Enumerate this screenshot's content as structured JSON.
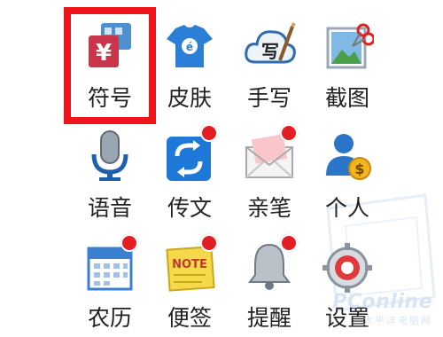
{
  "items": [
    {
      "label": "符号"
    },
    {
      "label": "皮肤"
    },
    {
      "label": "手写"
    },
    {
      "label": "截图"
    },
    {
      "label": "语音"
    },
    {
      "label": "传文"
    },
    {
      "label": "亲笔"
    },
    {
      "label": "个人"
    },
    {
      "label": "农历"
    },
    {
      "label": "便签"
    },
    {
      "label": "提醒"
    },
    {
      "label": "设置"
    }
  ],
  "icons": {
    "symbol_text": "¥",
    "note_text": "NOTE"
  },
  "watermark": {
    "brand": "PConline",
    "sub": "太平洋电脑网"
  },
  "colors": {
    "highlight": "#f0151a",
    "badge": "#e21d24",
    "accent_blue": "#1e78d7"
  }
}
